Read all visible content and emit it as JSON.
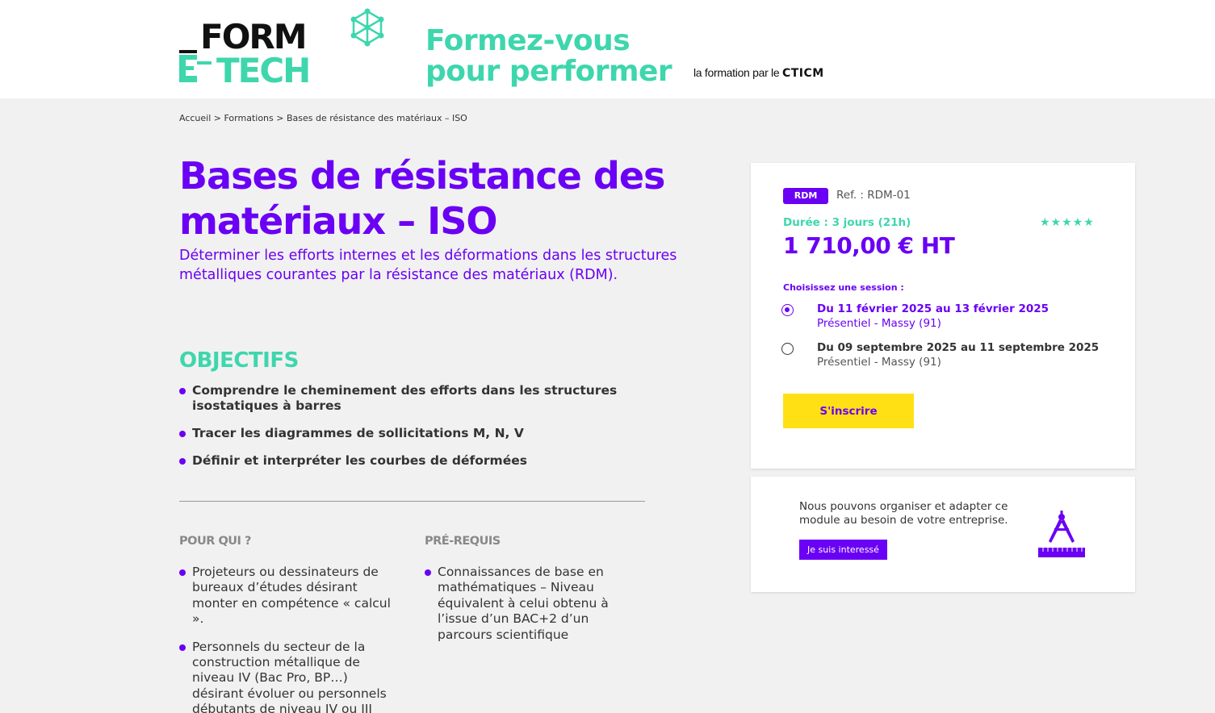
{
  "header": {
    "logo": {
      "line1": "FORM",
      "line2": "E-TECH"
    },
    "tagline_line1": "Formez-vous",
    "tagline_line2": "pour performer",
    "partner_prefix": "la formation par le ",
    "partner_brand": "CTICM"
  },
  "breadcrumb": {
    "items": [
      "Accueil",
      "Formations",
      "Bases de résistance des matériaux – ISO"
    ],
    "separator": ">"
  },
  "page": {
    "title_line1": "Bases de résistance des",
    "title_line2": "matériaux – ISO",
    "subtitle": "Déterminer les efforts internes et les déformations dans les structures métalliques courantes par la résistance des matériaux (RDM)."
  },
  "objectifs": {
    "heading": "OBJECTIFS",
    "items": [
      "Comprendre le cheminement des efforts dans les structures isostatiques à barres",
      "Tracer les diagrammes de sollicitations M, N, V",
      "Définir et interpréter les courbes de déformées"
    ]
  },
  "pour_qui": {
    "heading": "POUR QUI ?",
    "items": [
      "Projeteurs ou dessinateurs de bureaux d’études désirant monter en compétence « calcul ».",
      "Personnels du secteur de la construction métallique de niveau IV (Bac Pro, BP…) désirant évoluer ou personnels débutants de niveau IV ou III provenant d’autres disciplines."
    ]
  },
  "prerequis": {
    "heading": "PRÉ-REQUIS",
    "items": [
      "Connaissances de base en mathématiques – Niveau équivalent à celui obtenu à l’issue d’un BAC+2 d’un parcours scientifique"
    ]
  },
  "booking": {
    "tag": "RDM",
    "ref": "Ref. : RDM-01",
    "duree": "Durée : 3 jours (21h)",
    "rating": 4.5,
    "stars_icon": "★★★★★",
    "price": "1 710,00 € HT",
    "session_label": "Choisissez une session :",
    "sessions": [
      {
        "dates": "Du 11 février 2025 au 13 février 2025",
        "place": "Présentiel - Massy (91)",
        "selected": true
      },
      {
        "dates": "Du 09 septembre 2025 au 11 septembre 2025",
        "place": "Présentiel - Massy (91)",
        "selected": false
      }
    ],
    "cta": "S'inscrire"
  },
  "custom": {
    "text": "Nous pouvons organiser et adapter ce module au besoin de votre entreprise.",
    "cta": "Je suis interessé",
    "icon": "compass-ruler-icon"
  },
  "colors": {
    "purple": "#6a00f4",
    "green": "#3ed6ad",
    "yellow": "#ffe014",
    "background": "#f1f1f1"
  }
}
